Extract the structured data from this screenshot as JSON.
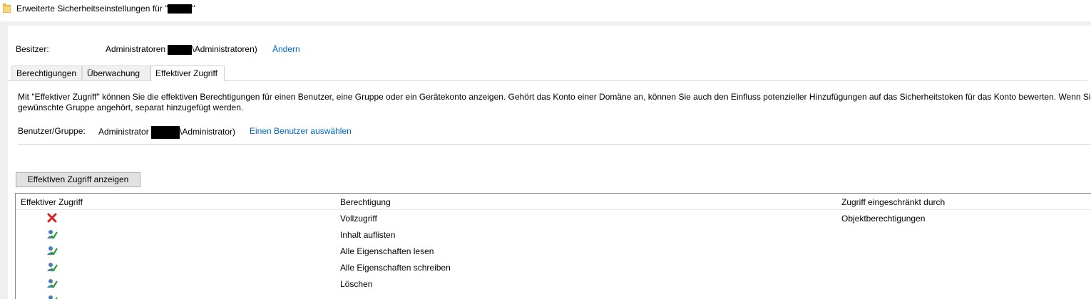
{
  "window": {
    "title": "Erweiterte Sicherheitseinstellungen für \"",
    "title_suffix": "\"",
    "folder_icon": "folder-icon"
  },
  "owner": {
    "label": "Besitzer:",
    "value_prefix": "Administratoren (",
    "value_suffix": "\\Administratoren)",
    "change_link": "Ändern"
  },
  "tabs": [
    {
      "label": "Berechtigungen",
      "active": false
    },
    {
      "label": "Überwachung",
      "active": false
    },
    {
      "label": "Effektiver Zugriff",
      "active": true
    }
  ],
  "effective_access": {
    "description": "Mit \"Effektiver Zugriff\" können Sie die effektiven Berechtigungen für einen Benutzer, eine Gruppe oder ein Gerätekonto anzeigen. Gehört das Konto einer Domäne an, können Sie auch den Einfluss potenzieller Hinzufügungen auf das Sicherheitstoken für das Konto bewerten. Wenn Sie das",
    "description_line2": "gewünschte Gruppe angehört, separat hinzugefügt werden.",
    "user_label": "Benutzer/Gruppe:",
    "user_prefix": "Administrator (",
    "user_suffix": "\\Administrator)",
    "select_user_link": "Einen Benutzer auswählen",
    "view_button": "Effektiven Zugriff anzeigen"
  },
  "table": {
    "columns": [
      "Effektiver Zugriff",
      "Berechtigung",
      "Zugriff eingeschränkt durch"
    ],
    "rows": [
      {
        "status_icon": "denied-x-icon",
        "permission": "Vollzugriff",
        "restricted_by": "Objektberechtigungen"
      },
      {
        "status_icon": "allowed-user-check-icon",
        "permission": "Inhalt auflisten",
        "restricted_by": ""
      },
      {
        "status_icon": "allowed-user-check-icon",
        "permission": "Alle Eigenschaften lesen",
        "restricted_by": ""
      },
      {
        "status_icon": "allowed-user-check-icon",
        "permission": "Alle Eigenschaften schreiben",
        "restricted_by": ""
      },
      {
        "status_icon": "allowed-user-check-icon",
        "permission": "Löschen",
        "restricted_by": ""
      },
      {
        "status_icon": "allowed-user-check-icon",
        "permission": "",
        "restricted_by": ""
      }
    ]
  },
  "colors": {
    "link": "#0066cc",
    "deny": "#d81e1e",
    "check": "#2e9e2e"
  }
}
